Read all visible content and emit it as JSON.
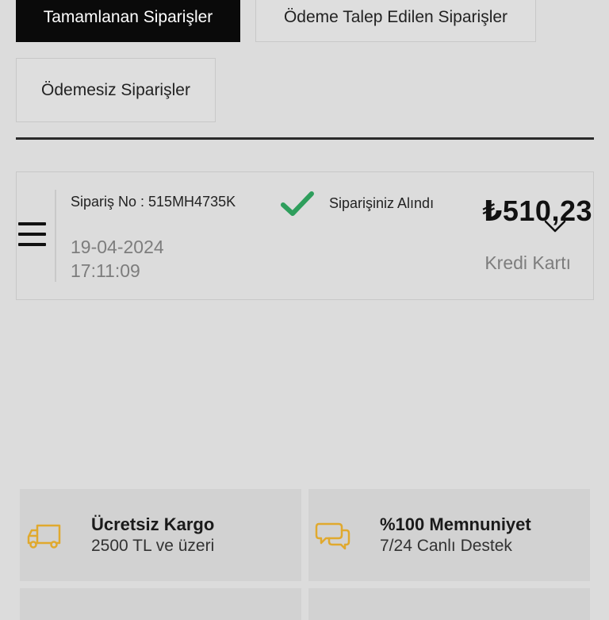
{
  "tabs": {
    "completed": "Tamamlanan Siparişler",
    "payment_requested": "Ödeme Talep Edilen Siparişler",
    "unpaid": "Ödemesiz Siparişler"
  },
  "order": {
    "number": "Sipariş No : 515MH4735K",
    "date": "19-04-2024",
    "time": "17:11:09",
    "status": "Siparişiniz Alındı",
    "price": "₺510,23",
    "payment_method": "Kredi Kartı"
  },
  "features": [
    {
      "title": "Ücretsiz Kargo",
      "subtitle": "2500 TL ve üzeri",
      "icon": "truck-icon"
    },
    {
      "title": "%100 Memnuniyet",
      "subtitle": "7/24 Canlı Destek",
      "icon": "chat-bubbles-icon"
    }
  ],
  "colors": {
    "active_tab_bg": "#0a0a0a",
    "check_green": "#2e9e5c",
    "feature_icon_gold": "#e0a92e",
    "background": "#dcdcdc"
  }
}
